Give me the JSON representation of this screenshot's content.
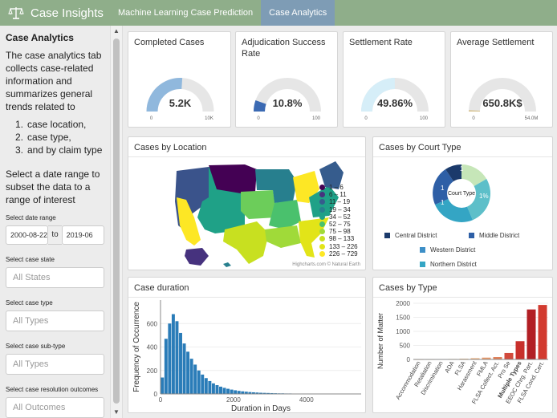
{
  "header": {
    "brand": "Case Insights",
    "tabs": [
      {
        "label": "Machine Learning Case Prediction",
        "active": false
      },
      {
        "label": "Case Analytics",
        "active": true
      }
    ]
  },
  "sidebar": {
    "title": "Case Analytics",
    "intro": "The case analytics tab collects case-related information and summarizes general trends related to",
    "list": [
      {
        "num": "1.",
        "text": "case location,"
      },
      {
        "num": "2.",
        "text": "case type,"
      },
      {
        "num": "3.",
        "text": "and by claim type"
      }
    ],
    "date_intro": "Select a date range to subset the data to a range of interest",
    "date_range_label": "Select date range",
    "date_start": "2000-08-22",
    "date_to": "to",
    "date_end": "2019-06",
    "state_label": "Select case state",
    "state_placeholder": "All States",
    "type_label": "Select case type",
    "type_placeholder": "All Types",
    "subtype_label": "Select case sub-type",
    "subtype_placeholder": "All Types",
    "outcome_label": "Select case resolution outcomes",
    "outcome_placeholder": "All Outcomes"
  },
  "gauges": [
    {
      "title": "Completed Cases",
      "value": "5.2K",
      "min": "0",
      "max": "10K",
      "fraction": 0.52,
      "color": "#90b8dd"
    },
    {
      "title": "Adjudication Success Rate",
      "value": "10.8%",
      "min": "0",
      "max": "100",
      "fraction": 0.108,
      "color": "#3b6ab3"
    },
    {
      "title": "Settlement Rate",
      "value": "49.86%",
      "min": "0",
      "max": "100",
      "fraction": 0.4986,
      "color": "#d6eef8"
    },
    {
      "title": "Average Settlement",
      "value": "650.8K$",
      "min": "0",
      "max": "54.0M",
      "fraction": 0.012,
      "color": "#d6c08a"
    }
  ],
  "location_card": {
    "title": "Cases by Location",
    "legend": [
      {
        "label": "1 – 6",
        "color": "#440154"
      },
      {
        "label": "6 – 11",
        "color": "#46327e"
      },
      {
        "label": "11 – 19",
        "color": "#365c8d"
      },
      {
        "label": "19 – 34",
        "color": "#277f8e"
      },
      {
        "label": "34 – 52",
        "color": "#1fa187"
      },
      {
        "label": "52 – 75",
        "color": "#4ac16d"
      },
      {
        "label": "75 – 98",
        "color": "#a0da39"
      },
      {
        "label": "98 – 133",
        "color": "#c8e020"
      },
      {
        "label": "133 – 226",
        "color": "#e2e418"
      },
      {
        "label": "226 – 729",
        "color": "#fde725"
      }
    ],
    "credit": "Highcharts.com © Natural Earth"
  },
  "court_card": {
    "title": "Cases by Court Type",
    "center_label": "Court Type",
    "slice_labels": [
      "1",
      "1",
      "1",
      "1%"
    ],
    "legend": [
      {
        "label": "Central District",
        "color": "#1b3a6b"
      },
      {
        "label": "Middle District",
        "color": "#2e5fa6"
      },
      {
        "label": "Western District",
        "color": "#3d8fc7"
      },
      {
        "label": "Northern District",
        "color": "#34a5c4"
      }
    ]
  },
  "colors": {
    "navbar": "#8fae8a",
    "active_tab": "#7e9cb5",
    "histogram_bar": "#2a7cb8"
  },
  "chart_data": [
    {
      "type": "bar",
      "title": "Case duration",
      "xlabel": "Duration in Days",
      "ylabel": "Frequency of Occurrence",
      "xlim": [
        0,
        5500
      ],
      "ylim": [
        0,
        800
      ],
      "x_ticks": [
        "0",
        "2000",
        "4000"
      ],
      "y_ticks": [
        "0",
        "200",
        "400",
        "600"
      ],
      "bin_width": 100,
      "x": [
        0,
        100,
        200,
        300,
        400,
        500,
        600,
        700,
        800,
        900,
        1000,
        1100,
        1200,
        1300,
        1400,
        1500,
        1600,
        1700,
        1800,
        1900,
        2000,
        2100,
        2200,
        2300,
        2400,
        2500,
        2600,
        2700,
        2800,
        2900,
        3000,
        3100,
        3200,
        3300,
        3400,
        3500,
        3600,
        3700,
        3800,
        3900,
        4000,
        4100,
        4200,
        4300,
        4400,
        4500,
        4600,
        4700,
        4800,
        4900,
        5000
      ],
      "values": [
        140,
        470,
        600,
        680,
        620,
        520,
        430,
        360,
        300,
        250,
        200,
        165,
        135,
        110,
        90,
        75,
        62,
        52,
        44,
        37,
        31,
        26,
        22,
        19,
        16,
        14,
        12,
        10,
        9,
        8,
        7,
        6,
        5,
        5,
        4,
        4,
        3,
        3,
        3,
        2,
        2,
        2,
        2,
        1,
        1,
        1,
        1,
        1,
        1,
        1,
        1
      ]
    },
    {
      "type": "bar",
      "title": "Cases by Type",
      "xlabel": "",
      "ylabel": "Number of Matter",
      "ylim": [
        0,
        2000
      ],
      "y_ticks": [
        "0",
        "500",
        "1000",
        "1500",
        "2000"
      ],
      "categories": [
        "Accommodation",
        "Retaliation",
        "Discrimination",
        "ADA",
        "FLSA",
        "Harassment",
        "FMLA",
        "FLSA Collect. Act.",
        "Pro Se",
        "Multiple Types",
        "EEOC Chrg. Part.",
        "FLSA Cond. Cert."
      ],
      "values": [
        3,
        6,
        10,
        18,
        28,
        45,
        65,
        85,
        230,
        650,
        1780,
        1940
      ],
      "colors": [
        "#f4e1c4",
        "#f4e1c4",
        "#f4dbb8",
        "#f2d2a8",
        "#f0c394",
        "#eeb07e",
        "#e99a6a",
        "#e07f58",
        "#d24a3c",
        "#c8302c",
        "#b21f24",
        "#d23a2f"
      ]
    }
  ]
}
